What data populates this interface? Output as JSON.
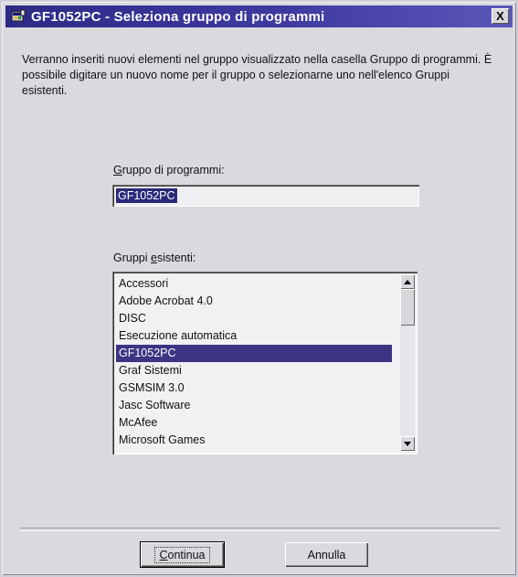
{
  "window": {
    "title": "GF1052PC - Seleziona gruppo di programmi",
    "close_label": "X"
  },
  "description": "Verranno inseriti nuovi elementi nel gruppo visualizzato nella casella Gruppo di programmi. È possibile digitare un nuovo nome per il gruppo o selezionarne uno nell'elenco Gruppi esistenti.",
  "group_field": {
    "label_underlined": "G",
    "label_rest": "ruppo di programmi:",
    "value": "GF1052PC"
  },
  "existing_groups": {
    "label_prefix": "Gruppi ",
    "label_underlined": "e",
    "label_rest": "sistenti:",
    "items": [
      "Accessori",
      "Adobe Acrobat 4.0",
      "DISC",
      "Esecuzione automatica",
      "GF1052PC",
      "Graf Sistemi",
      "GSMSIM 3.0",
      "Jasc Software",
      "McAfee",
      "Microsoft Games"
    ],
    "selected_index": 4
  },
  "buttons": {
    "continue_underlined": "C",
    "continue_rest": "ontinua",
    "cancel_label": "Annulla"
  },
  "icons": {
    "title_icon": "program-group-icon",
    "scroll_up": "scroll-up-arrow-icon",
    "scroll_down": "scroll-down-arrow-icon"
  }
}
